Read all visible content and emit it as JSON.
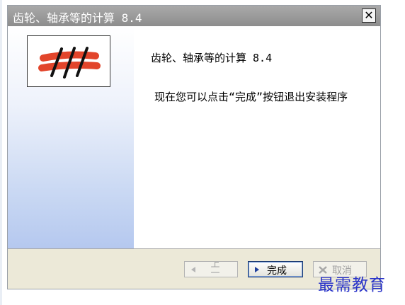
{
  "window": {
    "title": "齿轮、轴承等的计算 8.4",
    "close_glyph": "✕"
  },
  "content": {
    "heading": "齿轮、轴承等的计算 8.4",
    "message": "现在您可以点击“完成”按钮退出安装程序"
  },
  "buttons": {
    "back_label": "上一步",
    "finish_label": "完成",
    "cancel_label": "取消"
  },
  "watermark": {
    "text": "最需教育"
  },
  "colors": {
    "titlebar": "#999999",
    "sidebar_gradient_end": "#b5c8ef",
    "logo_stroke": "#e2452b",
    "watermark": "#2b35c9"
  }
}
